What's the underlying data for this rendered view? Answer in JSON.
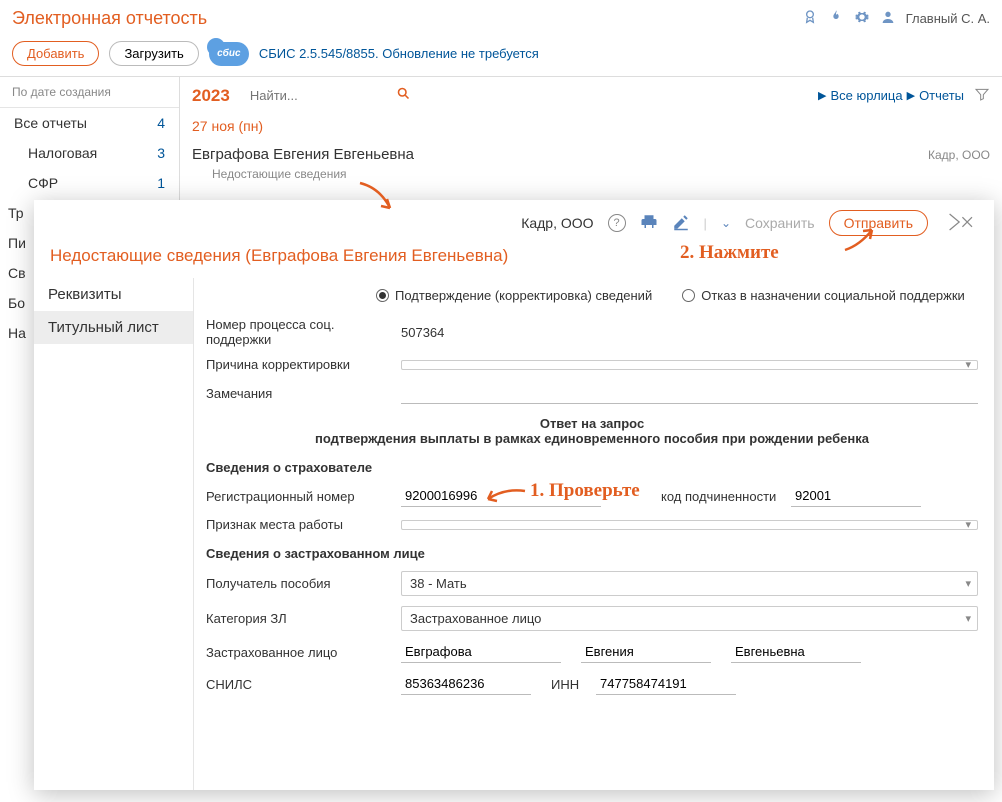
{
  "header": {
    "title": "Электронная отчетость",
    "user": "Главный С. А."
  },
  "toolbar": {
    "add": "Добавить",
    "upload": "Загрузить",
    "cloud": "сбис",
    "status": "СБИС 2.5.545/8855. Обновление не требуется"
  },
  "sidebar": {
    "header": "По дате создания",
    "all": {
      "label": "Все отчеты",
      "count": "4"
    },
    "tax": {
      "label": "Налоговая",
      "count": "3"
    },
    "sfr": {
      "label": "СФР",
      "count": "1"
    },
    "tr": "Тр",
    "pi": "Пи",
    "sv": "Св",
    "bo": "Бо",
    "na": "На"
  },
  "content": {
    "year": "2023",
    "search_placeholder": "Найти...",
    "all_entities": "Все юрлица",
    "reports": "Отчеты",
    "date": "27 ноя (пн)",
    "person": "Евграфова Евгения Евгеньевна",
    "org": "Кадр, ООО",
    "subtitle": "Недостающие сведения"
  },
  "modal": {
    "org": "Кадр, ООО",
    "save": "Сохранить",
    "send": "Отправить",
    "title": "Недостающие сведения (Евграфова Евгения Евгеньевна)",
    "nav": {
      "req": "Реквизиты",
      "title_page": "Титульный лист"
    },
    "radio": {
      "confirm": "Подтверждение (корректировка) сведений",
      "deny": "Отказ в назначении социальной поддержки"
    },
    "fields": {
      "proc_num_lbl": "Номер процесса соц. поддержки",
      "proc_num": "507364",
      "reason_lbl": "Причина корректировки",
      "notes_lbl": "Замечания",
      "response_t1": "Ответ на запрос",
      "response_t2": "подтверждения выплаты в рамках единовременного пособия при рождении ребенка",
      "insurer_h": "Сведения о страхователе",
      "reg_num_lbl": "Регистрационный номер",
      "reg_num": "9200016996",
      "sub_code_lbl": "код подчиненности",
      "sub_code": "92001",
      "work_sign_lbl": "Признак места работы",
      "insured_h": "Сведения о застрахованном лице",
      "recipient_lbl": "Получатель пособия",
      "recipient_val": "38 - Мать",
      "cat_lbl": "Категория ЗЛ",
      "cat_val": "Застрахованное лицо",
      "person_lbl": "Застрахованное лицо",
      "lastname": "Евграфова",
      "firstname": "Евгения",
      "middlename": "Евгеньевна",
      "snils_lbl": "СНИЛС",
      "snils": "85363486236",
      "inn_lbl": "ИНН",
      "inn": "747758474191"
    }
  },
  "notes": {
    "n1": "1. Проверьте",
    "n2": "2. Нажмите"
  }
}
